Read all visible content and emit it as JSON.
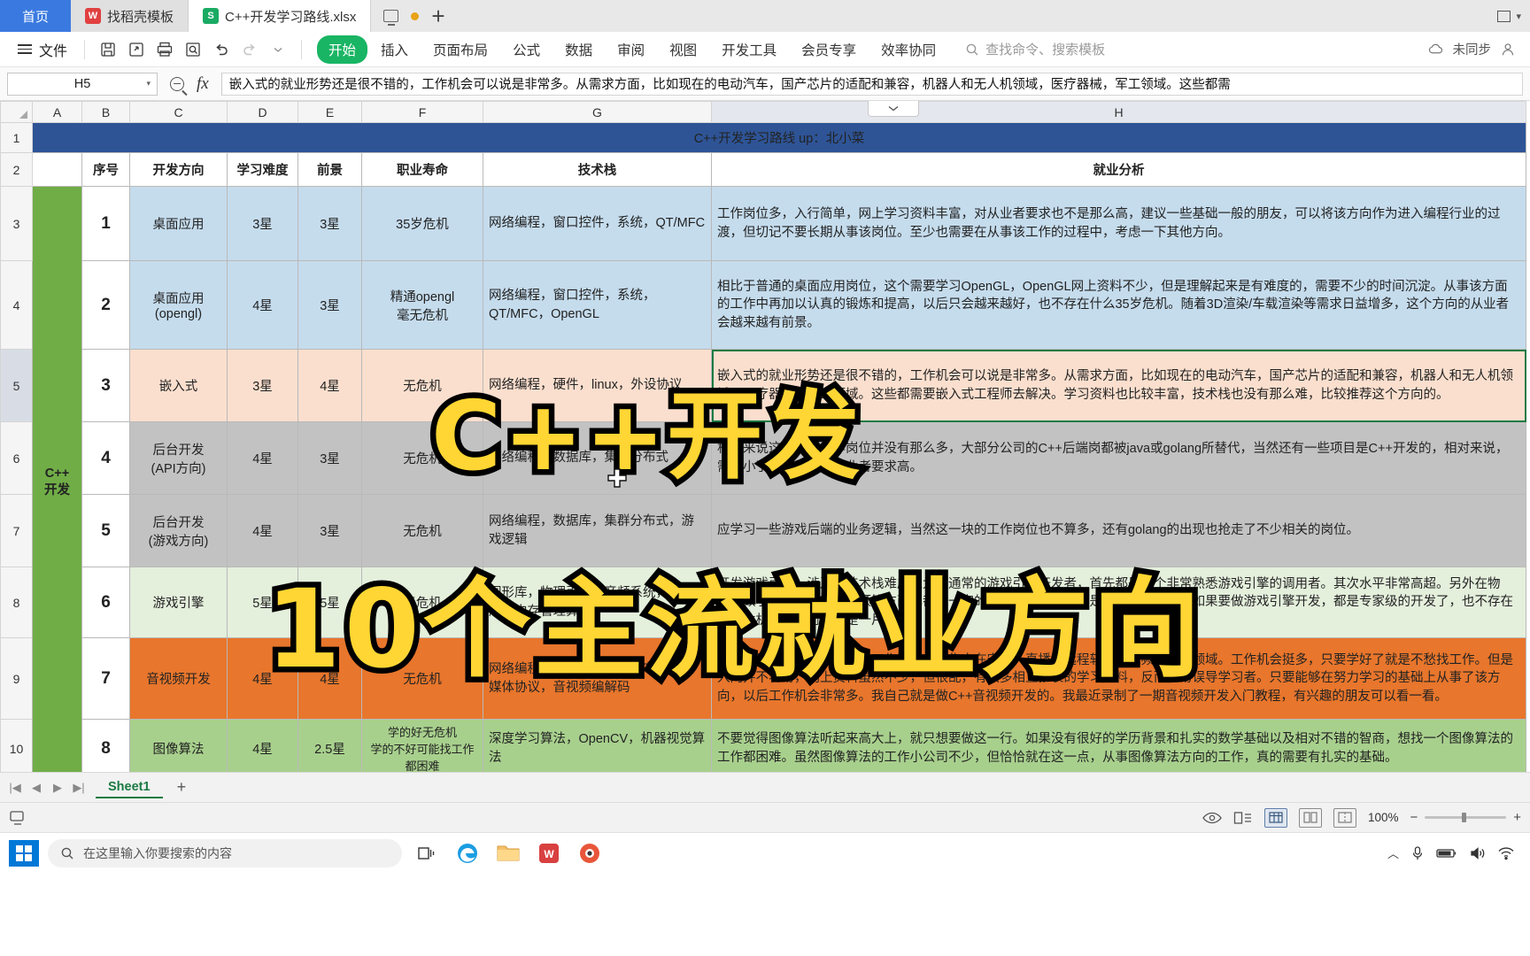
{
  "window": {
    "tabs": [
      {
        "label": "首页",
        "icon": "home-tab",
        "type": "home"
      },
      {
        "label": "找稻壳模板",
        "icon": "docer-icon",
        "type": "docer"
      },
      {
        "label": "C++开发学习路线.xlsx",
        "icon": "sheet-icon",
        "type": "doc",
        "active": true
      }
    ],
    "new_tab_label": "+",
    "restore_label": "1"
  },
  "ribbon": {
    "file_label": "文件",
    "quick_icons": [
      "save-icon",
      "save-as-icon",
      "print-icon",
      "print-preview-icon",
      "undo-icon",
      "redo-icon",
      "customize-caret-icon"
    ],
    "tabs": [
      {
        "label": "开始",
        "active": true
      },
      {
        "label": "插入",
        "active": false
      },
      {
        "label": "页面布局",
        "active": false
      },
      {
        "label": "公式",
        "active": false
      },
      {
        "label": "数据",
        "active": false
      },
      {
        "label": "审阅",
        "active": false
      },
      {
        "label": "视图",
        "active": false
      },
      {
        "label": "开发工具",
        "active": false
      },
      {
        "label": "会员专享",
        "active": false
      },
      {
        "label": "效率协同",
        "active": false
      }
    ],
    "search_placeholder": "查找命令、搜索模板",
    "sync_status": "未同步"
  },
  "formula_bar": {
    "name_box": "H5",
    "content": "嵌入式的就业形势还是很不错的，工作机会可以说是非常多。从需求方面，比如现在的电动汽车，国产芯片的适配和兼容，机器人和无人机领域，医疗器械，军工领域。这些都需"
  },
  "grid": {
    "columns": [
      "A",
      "B",
      "C",
      "D",
      "E",
      "F",
      "G",
      "H"
    ],
    "selected_column": "H",
    "rows": [
      "1",
      "2",
      "3",
      "4",
      "5",
      "6",
      "7",
      "8",
      "9",
      "10"
    ],
    "selected_row": "5",
    "title": "C++开发学习路线  up：北小菜",
    "side_label": "C++\n开发",
    "headers": [
      "",
      "序号",
      "开发方向",
      "学习难度",
      "前景",
      "职业寿命",
      "技术栈",
      "就业分析"
    ],
    "data": [
      {
        "row": "3",
        "seq": "1",
        "direction": "桌面应用",
        "difficulty": "3星",
        "prospect": "3星",
        "career_life": "35岁危机",
        "tech_stack": "网络编程，窗口控件，系统，QT/MFC",
        "analysis": "工作岗位多，入行简单，网上学习资料丰富，对从业者要求也不是那么高，建议一些基础一般的朋友，可以将该方向作为进入编程行业的过渡，但切记不要长期从事该岗位。至少也需要在从事该工作的过程中，考虑一下其他方向。",
        "color": "#c5dced"
      },
      {
        "row": "4",
        "seq": "2",
        "direction": "桌面应用\n(opengl)",
        "difficulty": "4星",
        "prospect": "3星",
        "career_life": "精通opengl\n毫无危机",
        "tech_stack": "网络编程，窗口控件，系统，QT/MFC，OpenGL",
        "analysis": "相比于普通的桌面应用岗位，这个需要学习OpenGL，OpenGL网上资料不少，但是理解起来是有难度的，需要不少的时间沉淀。从事该方面的工作中再加以认真的锻炼和提高，以后只会越来越好，也不存在什么35岁危机。随着3D渲染/车载渲染等需求日益增多，这个方向的从业者会越来越有前景。",
        "color": "#c5dced"
      },
      {
        "row": "5",
        "seq": "3",
        "direction": "嵌入式",
        "difficulty": "3星",
        "prospect": "4星",
        "career_life": "无危机",
        "tech_stack": "网络编程，硬件，linux，外设协议",
        "analysis": "嵌入式的就业形势还是很不错的，工作机会可以说是非常多。从需求方面，比如现在的电动汽车，国产芯片的适配和兼容，机器人和无人机领域，医疗器械，军工领域。这些都需要嵌入式工程师去解决。学习资料也比较丰富，技术栈也没有那么难，比较推荐这个方向的。",
        "color": "#fbdfce",
        "selected": true
      },
      {
        "row": "6",
        "seq": "4",
        "direction": "后台开发\n(API方向)",
        "difficulty": "4星",
        "prospect": "3星",
        "career_life": "无危机",
        "tech_stack": "网络编程，数据库，集群分布式",
        "analysis": "相对来说这一块的工作岗位并没有那么多，大部分公司的C++后端岗都被java或golang所替代，当然还有一些项目是C++开发的，相对来说，需求小了很多，且对从业者要求高。",
        "color": "#c2c2c2"
      },
      {
        "row": "7",
        "seq": "5",
        "direction": "后台开发\n(游戏方向)",
        "difficulty": "4星",
        "prospect": "3星",
        "career_life": "无危机",
        "tech_stack": "网络编程，数据库，集群分布式，游戏逻辑",
        "analysis": "应学习一些游戏后端的业务逻辑，当然这一块的工作岗位也不算多，还有golang的出现也抢走了不少相关的岗位。",
        "color": "#c2c2c2"
      },
      {
        "row": "8",
        "seq": "6",
        "direction": "游戏引擎",
        "difficulty": "5星",
        "prospect": "5星",
        "career_life": "无危机",
        "tech_stack": "图形库，物理引擎，音频系统，数学库，内存管理算法",
        "analysis": "开发游戏引擎，涉及的技术栈难度过大，通常的游戏引擎开发者，首先都是一个非常熟悉游戏引擎的调用者。其次水平非常高超。另外在物理，数学，图形渲染，音频等方面也都有一定的要求，最重要的就是数学。当然了，如果要做游戏引擎开发，都是专家级的开发了，也不存在职业危机，工作前景也是一片坦途。",
        "color": "#e4efdc"
      },
      {
        "row": "9",
        "seq": "7",
        "direction": "音视频开发",
        "difficulty": "4星",
        "prospect": "4星",
        "career_life": "无危机",
        "tech_stack": "网络编程，数据库，集群分布式，流媒体协议，音视频编解码",
        "analysis": "现在也是挺火的一个方向，工作岗位主要集中在安防，直播，远程软件，视频会议等领域。工作机会挺多，只要学好了就是不愁找工作。但是入门并不容易，网上资料虽然不少，但很乱，有很多相互抄袭的学习资料，反而容易误导学习者。只要能够在努力学习的基础上从事了该方向，以后工作机会非常多。我自己就是做C++音视频开发的。我最近录制了一期音视频开发入门教程，有兴趣的朋友可以看一看。",
        "color": "#e8762c"
      },
      {
        "row": "10",
        "seq": "8",
        "direction": "图像算法",
        "difficulty": "4星",
        "prospect": "2.5星",
        "career_life": "学的好无危机\n学的不好可能找工作都困难",
        "tech_stack": "深度学习算法，OpenCV，机器视觉算法",
        "analysis": "不要觉得图像算法听起来高大上，就只想要做这一行。如果没有很好的学历背景和扎实的数学基础以及相对不错的智商，想找一个图像算法的工作都困难。虽然图像算法的工作小公司不少，但恰恰就在这一点，从事图像算法方向的工作，真的需要有扎实的基础。",
        "color": "#a8d08d"
      }
    ]
  },
  "overlay": {
    "line1": "C++开发",
    "line2": "10个主流就业方向",
    "fill_color": "#ffd633",
    "stroke_color": "#000000"
  },
  "sheet_bar": {
    "nav_first": "first-sheet-icon",
    "nav_prev": "prev-sheet-icon",
    "nav_next": "next-sheet-icon",
    "nav_last": "last-sheet-icon",
    "sheets": [
      "Sheet1"
    ],
    "add_label": "+"
  },
  "status_bar": {
    "left_icon": "screen-record-icon",
    "eye_icon": "preview-icon",
    "layout_icon": "layout-icon",
    "view_modes": [
      "normal-view-icon",
      "page-layout-icon",
      "page-break-icon"
    ],
    "zoom": "100%",
    "zoom_out": "−",
    "zoom_in": "+"
  },
  "taskbar": {
    "start_icon": "windows-start-icon",
    "search_placeholder": "在这里输入你要搜索的内容",
    "pinned": [
      "task-view-icon",
      "edge-icon",
      "explorer-icon",
      "wps-icon",
      "app-icon"
    ],
    "tray": [
      "chevron-up-icon",
      "mic-icon",
      "battery-icon",
      "volume-icon",
      "network-icon"
    ]
  }
}
